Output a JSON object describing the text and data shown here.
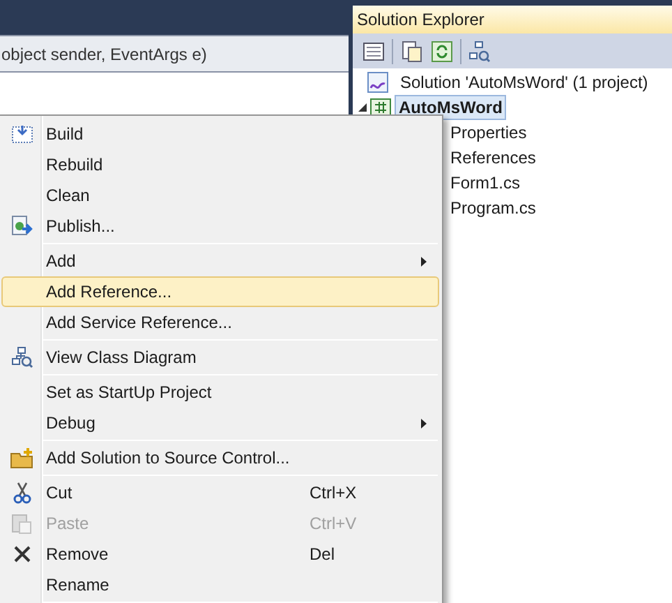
{
  "editor": {
    "member_dropdown": "object sender, EventArgs e)"
  },
  "solution_explorer": {
    "title": "Solution Explorer",
    "tree": [
      {
        "label": "Solution 'AutoMsWord' (1 project)",
        "selected": false,
        "children": [
          {
            "label": "AutoMsWord",
            "selected": true,
            "expanded": true,
            "children": [
              {
                "label": "Properties",
                "selected": false
              },
              {
                "label": "References",
                "selected": false
              },
              {
                "label": "Form1.cs",
                "selected": false
              },
              {
                "label": "Program.cs",
                "selected": false
              }
            ]
          }
        ]
      }
    ]
  },
  "context_menu": [
    {
      "kind": "item",
      "label": "Build",
      "selected": false,
      "disabled": false,
      "submenu": false
    },
    {
      "kind": "item",
      "label": "Rebuild",
      "selected": false,
      "disabled": false,
      "submenu": false
    },
    {
      "kind": "item",
      "label": "Clean",
      "selected": false,
      "disabled": false,
      "submenu": false
    },
    {
      "kind": "item",
      "label": "Publish...",
      "selected": false,
      "disabled": false,
      "submenu": false
    },
    {
      "kind": "separator"
    },
    {
      "kind": "item",
      "label": "Add",
      "selected": false,
      "disabled": false,
      "submenu": true
    },
    {
      "kind": "item",
      "label": "Add Reference...",
      "selected": true,
      "disabled": false,
      "submenu": false
    },
    {
      "kind": "item",
      "label": "Add Service Reference...",
      "selected": false,
      "disabled": false,
      "submenu": false
    },
    {
      "kind": "separator"
    },
    {
      "kind": "item",
      "label": "View Class Diagram",
      "selected": false,
      "disabled": false,
      "submenu": false
    },
    {
      "kind": "separator"
    },
    {
      "kind": "item",
      "label": "Set as StartUp Project",
      "selected": false,
      "disabled": false,
      "submenu": false
    },
    {
      "kind": "item",
      "label": "Debug",
      "selected": false,
      "disabled": false,
      "submenu": true
    },
    {
      "kind": "separator"
    },
    {
      "kind": "item",
      "label": "Add Solution to Source Control...",
      "selected": false,
      "disabled": false,
      "submenu": false
    },
    {
      "kind": "separator"
    },
    {
      "kind": "item",
      "label": "Cut",
      "shortcut": "Ctrl+X",
      "selected": false,
      "disabled": false,
      "submenu": false
    },
    {
      "kind": "item",
      "label": "Paste",
      "shortcut": "Ctrl+V",
      "selected": false,
      "disabled": true,
      "submenu": false
    },
    {
      "kind": "item",
      "label": "Remove",
      "shortcut": "Del",
      "selected": false,
      "disabled": false,
      "submenu": false
    },
    {
      "kind": "item",
      "label": "Rename",
      "selected": false,
      "disabled": false,
      "submenu": false
    },
    {
      "kind": "separator"
    }
  ]
}
